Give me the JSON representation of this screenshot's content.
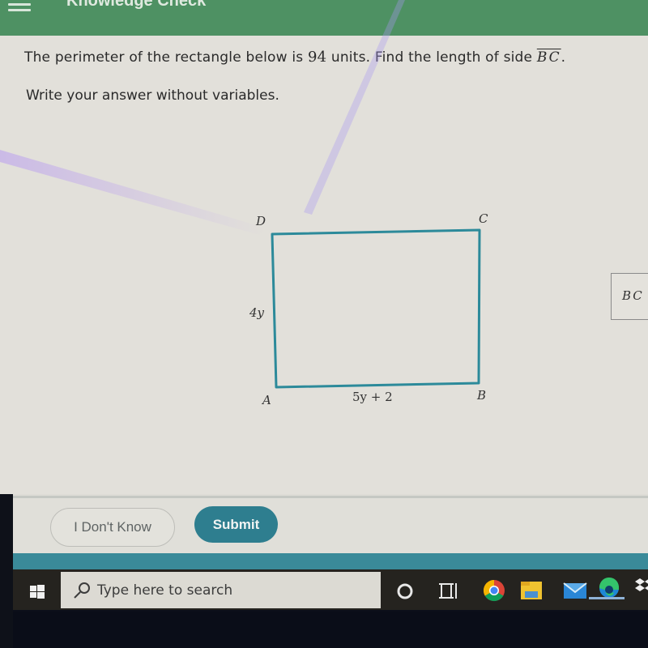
{
  "app": {
    "title": "Knowledge Check",
    "brand_color": "#4e9163"
  },
  "question": {
    "text_before_number": "The perimeter of the rectangle below is ",
    "perimeter": "94",
    "text_after_number": " units. Find the length of side ",
    "segment": "BC",
    "end": ".",
    "instruction": "Write your answer without variables."
  },
  "figure": {
    "shape": "rectangle",
    "vertices": {
      "A": "A",
      "B": "B",
      "C": "C",
      "D": "D"
    },
    "side_AD_label": "4y",
    "side_AB_label": "5y + 2",
    "stroke_color": "#2c8a9a"
  },
  "answer": {
    "label": "BC",
    "value": ""
  },
  "buttons": {
    "dont_know": "I Don't Know",
    "submit": "Submit",
    "submit_color": "#2e7e8f"
  },
  "taskbar": {
    "search_placeholder": "Type here to search",
    "icons": [
      "windows-start-icon",
      "cortana-icon",
      "task-view-icon",
      "chrome-icon",
      "file-explorer-icon",
      "mail-icon",
      "edge-icon",
      "dropbox-icon"
    ]
  }
}
